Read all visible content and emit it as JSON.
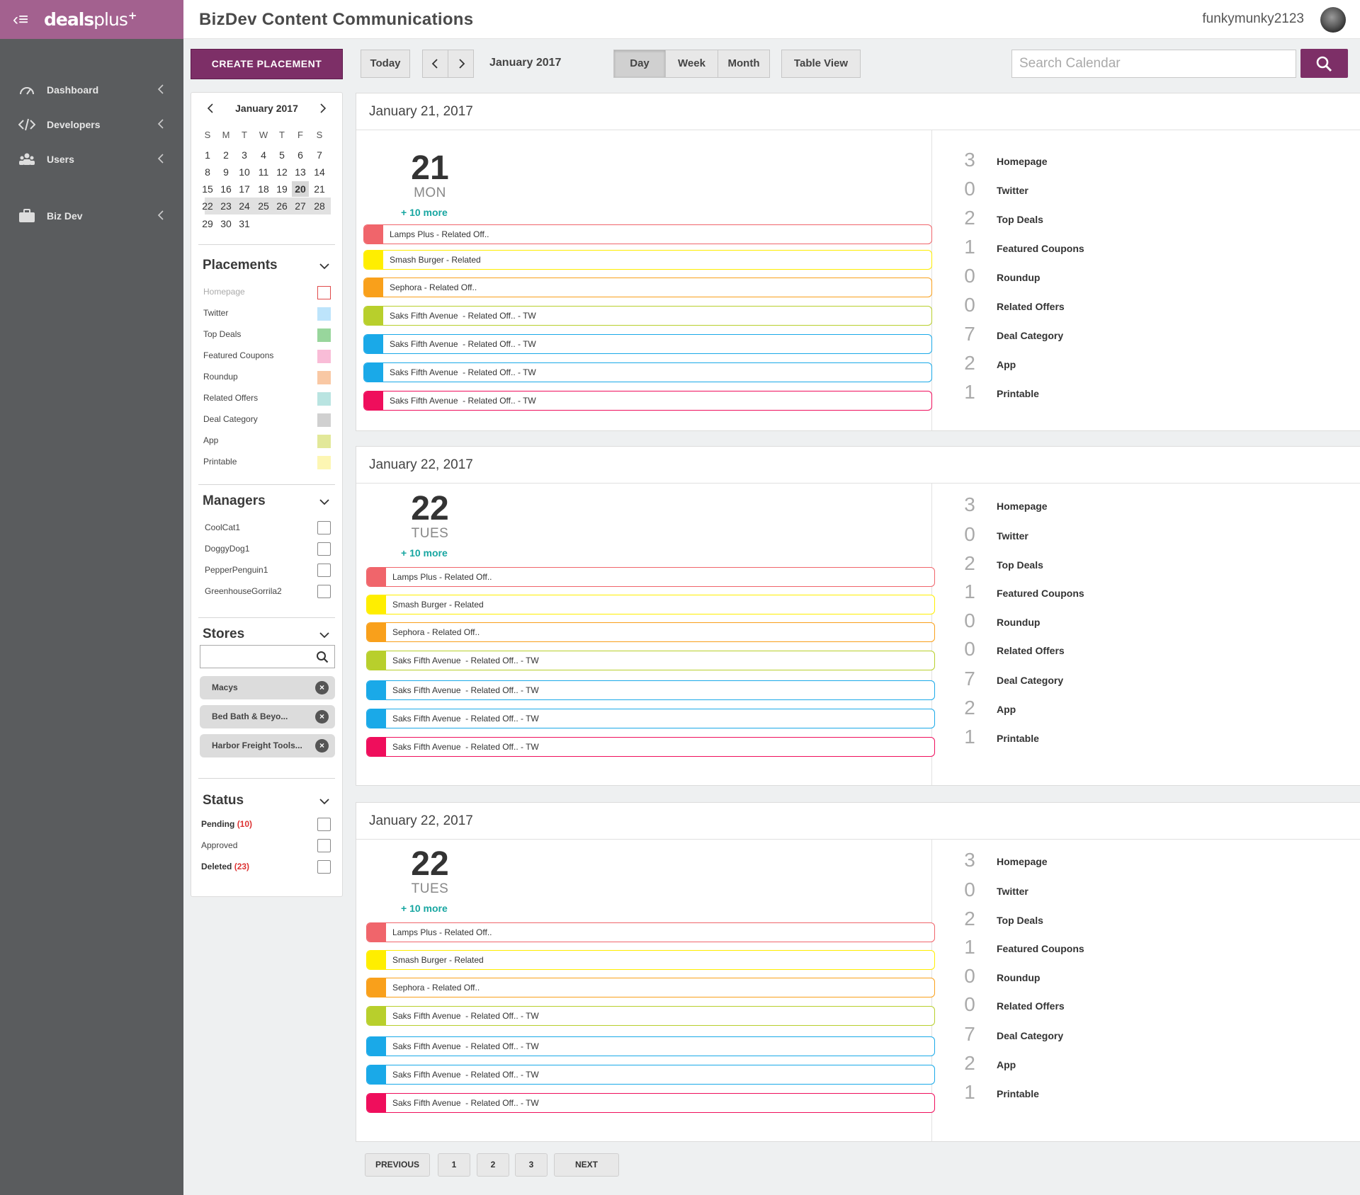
{
  "brand": {
    "logo_bold": "deals",
    "logo_thin": "plus",
    "logo_sup": "+"
  },
  "nav": [
    {
      "label": "Dashboard",
      "icon": "gauge-icon"
    },
    {
      "label": "Developers",
      "icon": "code-icon"
    },
    {
      "label": "Users",
      "icon": "users-icon"
    },
    {
      "label": "Biz Dev",
      "icon": "briefcase-icon"
    }
  ],
  "header": {
    "title": "BizDev Content Communications",
    "username": "funkymunky2123"
  },
  "sidebar": {
    "create_label": "CREATE PLACEMENT",
    "mini_calendar": {
      "month": "January 2017",
      "dow": [
        "S",
        "M",
        "T",
        "W",
        "T",
        "F",
        "S"
      ],
      "weeks": [
        [
          "1",
          "2",
          "3",
          "4",
          "5",
          "6",
          "7"
        ],
        [
          "8",
          "9",
          "10",
          "11",
          "12",
          "13",
          "14"
        ],
        [
          "15",
          "16",
          "17",
          "18",
          "19",
          "20",
          "21"
        ],
        [
          "22",
          "23",
          "24",
          "25",
          "26",
          "27",
          "28"
        ],
        [
          "29",
          "30",
          "31"
        ]
      ],
      "selected": "20"
    },
    "placements": {
      "title": "Placements",
      "items": [
        {
          "label": "Homepage",
          "color": "#ffffff",
          "border": "#e04a4a"
        },
        {
          "label": "Twitter",
          "color": "#bde4fb"
        },
        {
          "label": "Top Deals",
          "color": "#98d69c"
        },
        {
          "label": "Featured Coupons",
          "color": "#f9bcd7"
        },
        {
          "label": "Roundup",
          "color": "#f9c8a4"
        },
        {
          "label": "Related Offers",
          "color": "#b9e4e1"
        },
        {
          "label": "Deal Category",
          "color": "#d0d0d0"
        },
        {
          "label": "App",
          "color": "#e2e899"
        },
        {
          "label": "Printable",
          "color": "#fdf6b3"
        }
      ]
    },
    "managers": {
      "title": "Managers",
      "items": [
        "CoolCat1",
        "DoggyDog1",
        "PepperPenguin1",
        "GreenhouseGorrila2"
      ]
    },
    "stores": {
      "title": "Stores",
      "search_placeholder": "",
      "chips": [
        "Macys",
        "Bed Bath & Beyo...",
        "Harbor Freight Tools..."
      ]
    },
    "status": {
      "title": "Status",
      "items": [
        {
          "label": "Pending",
          "count": "(10)"
        },
        {
          "label": "Approved",
          "count": ""
        },
        {
          "label": "Deleted",
          "count": "(23)"
        }
      ]
    }
  },
  "toolbar": {
    "today": "Today",
    "month_label": "January 2017",
    "views": [
      "Day",
      "Week",
      "Month"
    ],
    "active_view": "Day",
    "table_view": "Table View",
    "search_placeholder": "Search Calendar"
  },
  "days": [
    {
      "heading": "January 21, 2017",
      "num": "21",
      "name": "MON",
      "more": "+ 10 more",
      "events": [
        {
          "label": "Lamps Plus - Related Off..",
          "color": "#f0656b"
        },
        {
          "label": "Smash Burger - Related",
          "color": "#ffee00"
        },
        {
          "label": "Sephora - Related Off..",
          "color": "#f9a01b"
        },
        {
          "label": "Saks Fifth Avenue  - Related Off.. - TW",
          "color": "#b8cf2c"
        },
        {
          "label": "Saks Fifth Avenue  - Related Off.. - TW",
          "color": "#1aa9e8"
        },
        {
          "label": "Saks Fifth Avenue  - Related Off.. - TW",
          "color": "#1aa9e8"
        },
        {
          "label": "Saks Fifth Avenue  - Related Off.. - TW",
          "color": "#ef0e5c"
        }
      ],
      "counts": [
        {
          "n": "3",
          "label": "Homepage"
        },
        {
          "n": "0",
          "label": "Twitter"
        },
        {
          "n": "2",
          "label": "Top Deals"
        },
        {
          "n": "1",
          "label": "Featured Coupons"
        },
        {
          "n": "0",
          "label": "Roundup"
        },
        {
          "n": "0",
          "label": "Related Offers"
        },
        {
          "n": "7",
          "label": "Deal Category"
        },
        {
          "n": "2",
          "label": "App"
        },
        {
          "n": "1",
          "label": "Printable"
        }
      ]
    },
    {
      "heading": "January 22, 2017",
      "num": "22",
      "name": "TUES",
      "more": "+ 10 more",
      "events": [
        {
          "label": "Lamps Plus - Related Off..",
          "color": "#f0656b"
        },
        {
          "label": "Smash Burger - Related",
          "color": "#ffee00"
        },
        {
          "label": "Sephora - Related Off..",
          "color": "#f9a01b"
        },
        {
          "label": "Saks Fifth Avenue  - Related Off.. - TW",
          "color": "#b8cf2c"
        },
        {
          "label": "Saks Fifth Avenue  - Related Off.. - TW",
          "color": "#1aa9e8"
        },
        {
          "label": "Saks Fifth Avenue  - Related Off.. - TW",
          "color": "#1aa9e8"
        },
        {
          "label": "Saks Fifth Avenue  - Related Off.. - TW",
          "color": "#ef0e5c"
        }
      ],
      "counts": [
        {
          "n": "3",
          "label": "Homepage"
        },
        {
          "n": "0",
          "label": "Twitter"
        },
        {
          "n": "2",
          "label": "Top Deals"
        },
        {
          "n": "1",
          "label": "Featured Coupons"
        },
        {
          "n": "0",
          "label": "Roundup"
        },
        {
          "n": "0",
          "label": "Related Offers"
        },
        {
          "n": "7",
          "label": "Deal Category"
        },
        {
          "n": "2",
          "label": "App"
        },
        {
          "n": "1",
          "label": "Printable"
        }
      ]
    },
    {
      "heading": "January 22, 2017",
      "num": "22",
      "name": "TUES",
      "more": "+ 10 more",
      "events": [
        {
          "label": "Lamps Plus - Related Off..",
          "color": "#f0656b"
        },
        {
          "label": "Smash Burger - Related",
          "color": "#ffee00"
        },
        {
          "label": "Sephora - Related Off..",
          "color": "#f9a01b"
        },
        {
          "label": "Saks Fifth Avenue  - Related Off.. - TW",
          "color": "#b8cf2c"
        },
        {
          "label": "Saks Fifth Avenue  - Related Off.. - TW",
          "color": "#1aa9e8"
        },
        {
          "label": "Saks Fifth Avenue  - Related Off.. - TW",
          "color": "#1aa9e8"
        },
        {
          "label": "Saks Fifth Avenue  - Related Off.. - TW",
          "color": "#ef0e5c"
        }
      ],
      "counts": [
        {
          "n": "3",
          "label": "Homepage"
        },
        {
          "n": "0",
          "label": "Twitter"
        },
        {
          "n": "2",
          "label": "Top Deals"
        },
        {
          "n": "1",
          "label": "Featured Coupons"
        },
        {
          "n": "0",
          "label": "Roundup"
        },
        {
          "n": "0",
          "label": "Related Offers"
        },
        {
          "n": "7",
          "label": "Deal Category"
        },
        {
          "n": "2",
          "label": "App"
        },
        {
          "n": "1",
          "label": "Printable"
        }
      ]
    }
  ],
  "pagination": {
    "previous": "PREVIOUS",
    "pages": [
      "1",
      "2",
      "3"
    ],
    "next": "NEXT"
  },
  "colors": {
    "brand": "#a3618f",
    "accent": "#7d2f67",
    "nav_bg": "#5a5c5e",
    "more_link": "#17a6a1",
    "count_red": "#dd3333"
  }
}
